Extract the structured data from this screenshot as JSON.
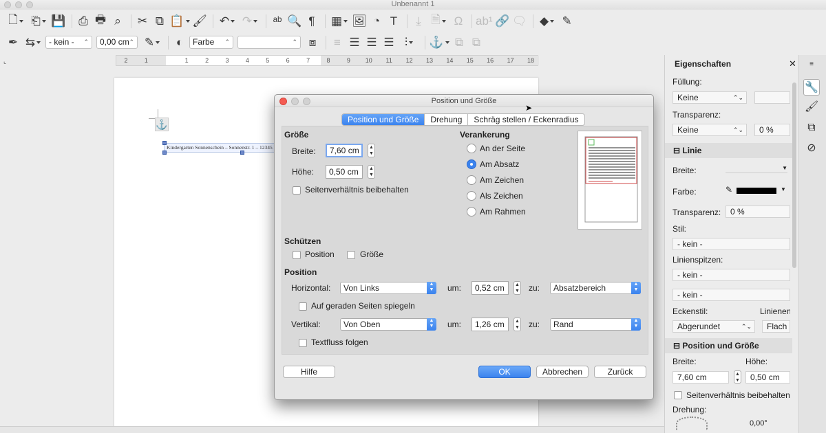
{
  "window": {
    "title": "Unbenannt 1"
  },
  "toolbar2": {
    "line_style": "- kein -",
    "line_width": "0,00 cm",
    "area_style": "Farbe",
    "area_value": ""
  },
  "ruler": {
    "ticks": [
      "2",
      "1",
      "",
      "1",
      "2",
      "3",
      "4",
      "5",
      "6",
      "7",
      "8",
      "9",
      "10",
      "11",
      "12",
      "13",
      "14",
      "15",
      "16",
      "17",
      "18"
    ]
  },
  "document": {
    "frame_text": "Kindergarten Sonnenschein – Sonnenstr. 1 – 12345 Musterstadt"
  },
  "dialog": {
    "title": "Position und Größe",
    "tabs": [
      "Position und Größe",
      "Drehung",
      "Schräg stellen / Eckenradius"
    ],
    "groesse": {
      "heading": "Größe",
      "width_label": "Breite:",
      "width_value": "7,60 cm",
      "height_label": "Höhe:",
      "height_value": "0,50 cm",
      "keep_ratio": "Seitenverhältnis beibehalten"
    },
    "verankerung": {
      "heading": "Verankerung",
      "options": [
        "An der Seite",
        "Am Absatz",
        "Am Zeichen",
        "Als Zeichen",
        "Am Rahmen"
      ],
      "selected": "Am Absatz"
    },
    "schuetzen": {
      "heading": "Schützen",
      "position": "Position",
      "size": "Größe"
    },
    "position": {
      "heading": "Position",
      "horizontal_label": "Horizontal:",
      "horizontal_value": "Von Links",
      "um_label": "um:",
      "h_by": "0,52 cm",
      "zu_label": "zu:",
      "h_to": "Absatzbereich",
      "mirror": "Auf geraden Seiten spiegeln",
      "vertical_label": "Vertikal:",
      "vertical_value": "Von Oben",
      "v_by": "1,26 cm",
      "v_to": "Rand",
      "follow": "Textfluss folgen"
    },
    "buttons": {
      "help": "Hilfe",
      "ok": "OK",
      "cancel": "Abbrechen",
      "back": "Zurück"
    }
  },
  "sidebar": {
    "title": "Eigenschaften",
    "fill_label": "Füllung:",
    "fill_value": "Keine",
    "transp_label": "Transparenz:",
    "transp_value": "Keine",
    "transp_pct": "0 %",
    "line_heading": "Linie",
    "line_width_label": "Breite:",
    "line_color_label": "Farbe:",
    "line_transp_label": "Transparenz:",
    "line_transp_value": "0 %",
    "style_label": "Stil:",
    "style_value": "- kein -",
    "arrow_label": "Linienspitzen:",
    "arrow_start": "- kein -",
    "arrow_end": "- kein -",
    "corner_label": "Eckenstil:",
    "cap_label": "Linienende:",
    "corner_value": "Abgerundet",
    "cap_value": "Flach",
    "pos_heading": "Position und Größe",
    "pos_width_label": "Breite:",
    "pos_height_label": "Höhe:",
    "pos_width": "7,60 cm",
    "pos_height": "0,50 cm",
    "pos_ratio": "Seitenverhältnis beibehalten",
    "rotation_label": "Drehung:",
    "rotation_value": "0,00°"
  },
  "colors": {
    "accent": "#3b83ee",
    "line_color": "#000000"
  }
}
